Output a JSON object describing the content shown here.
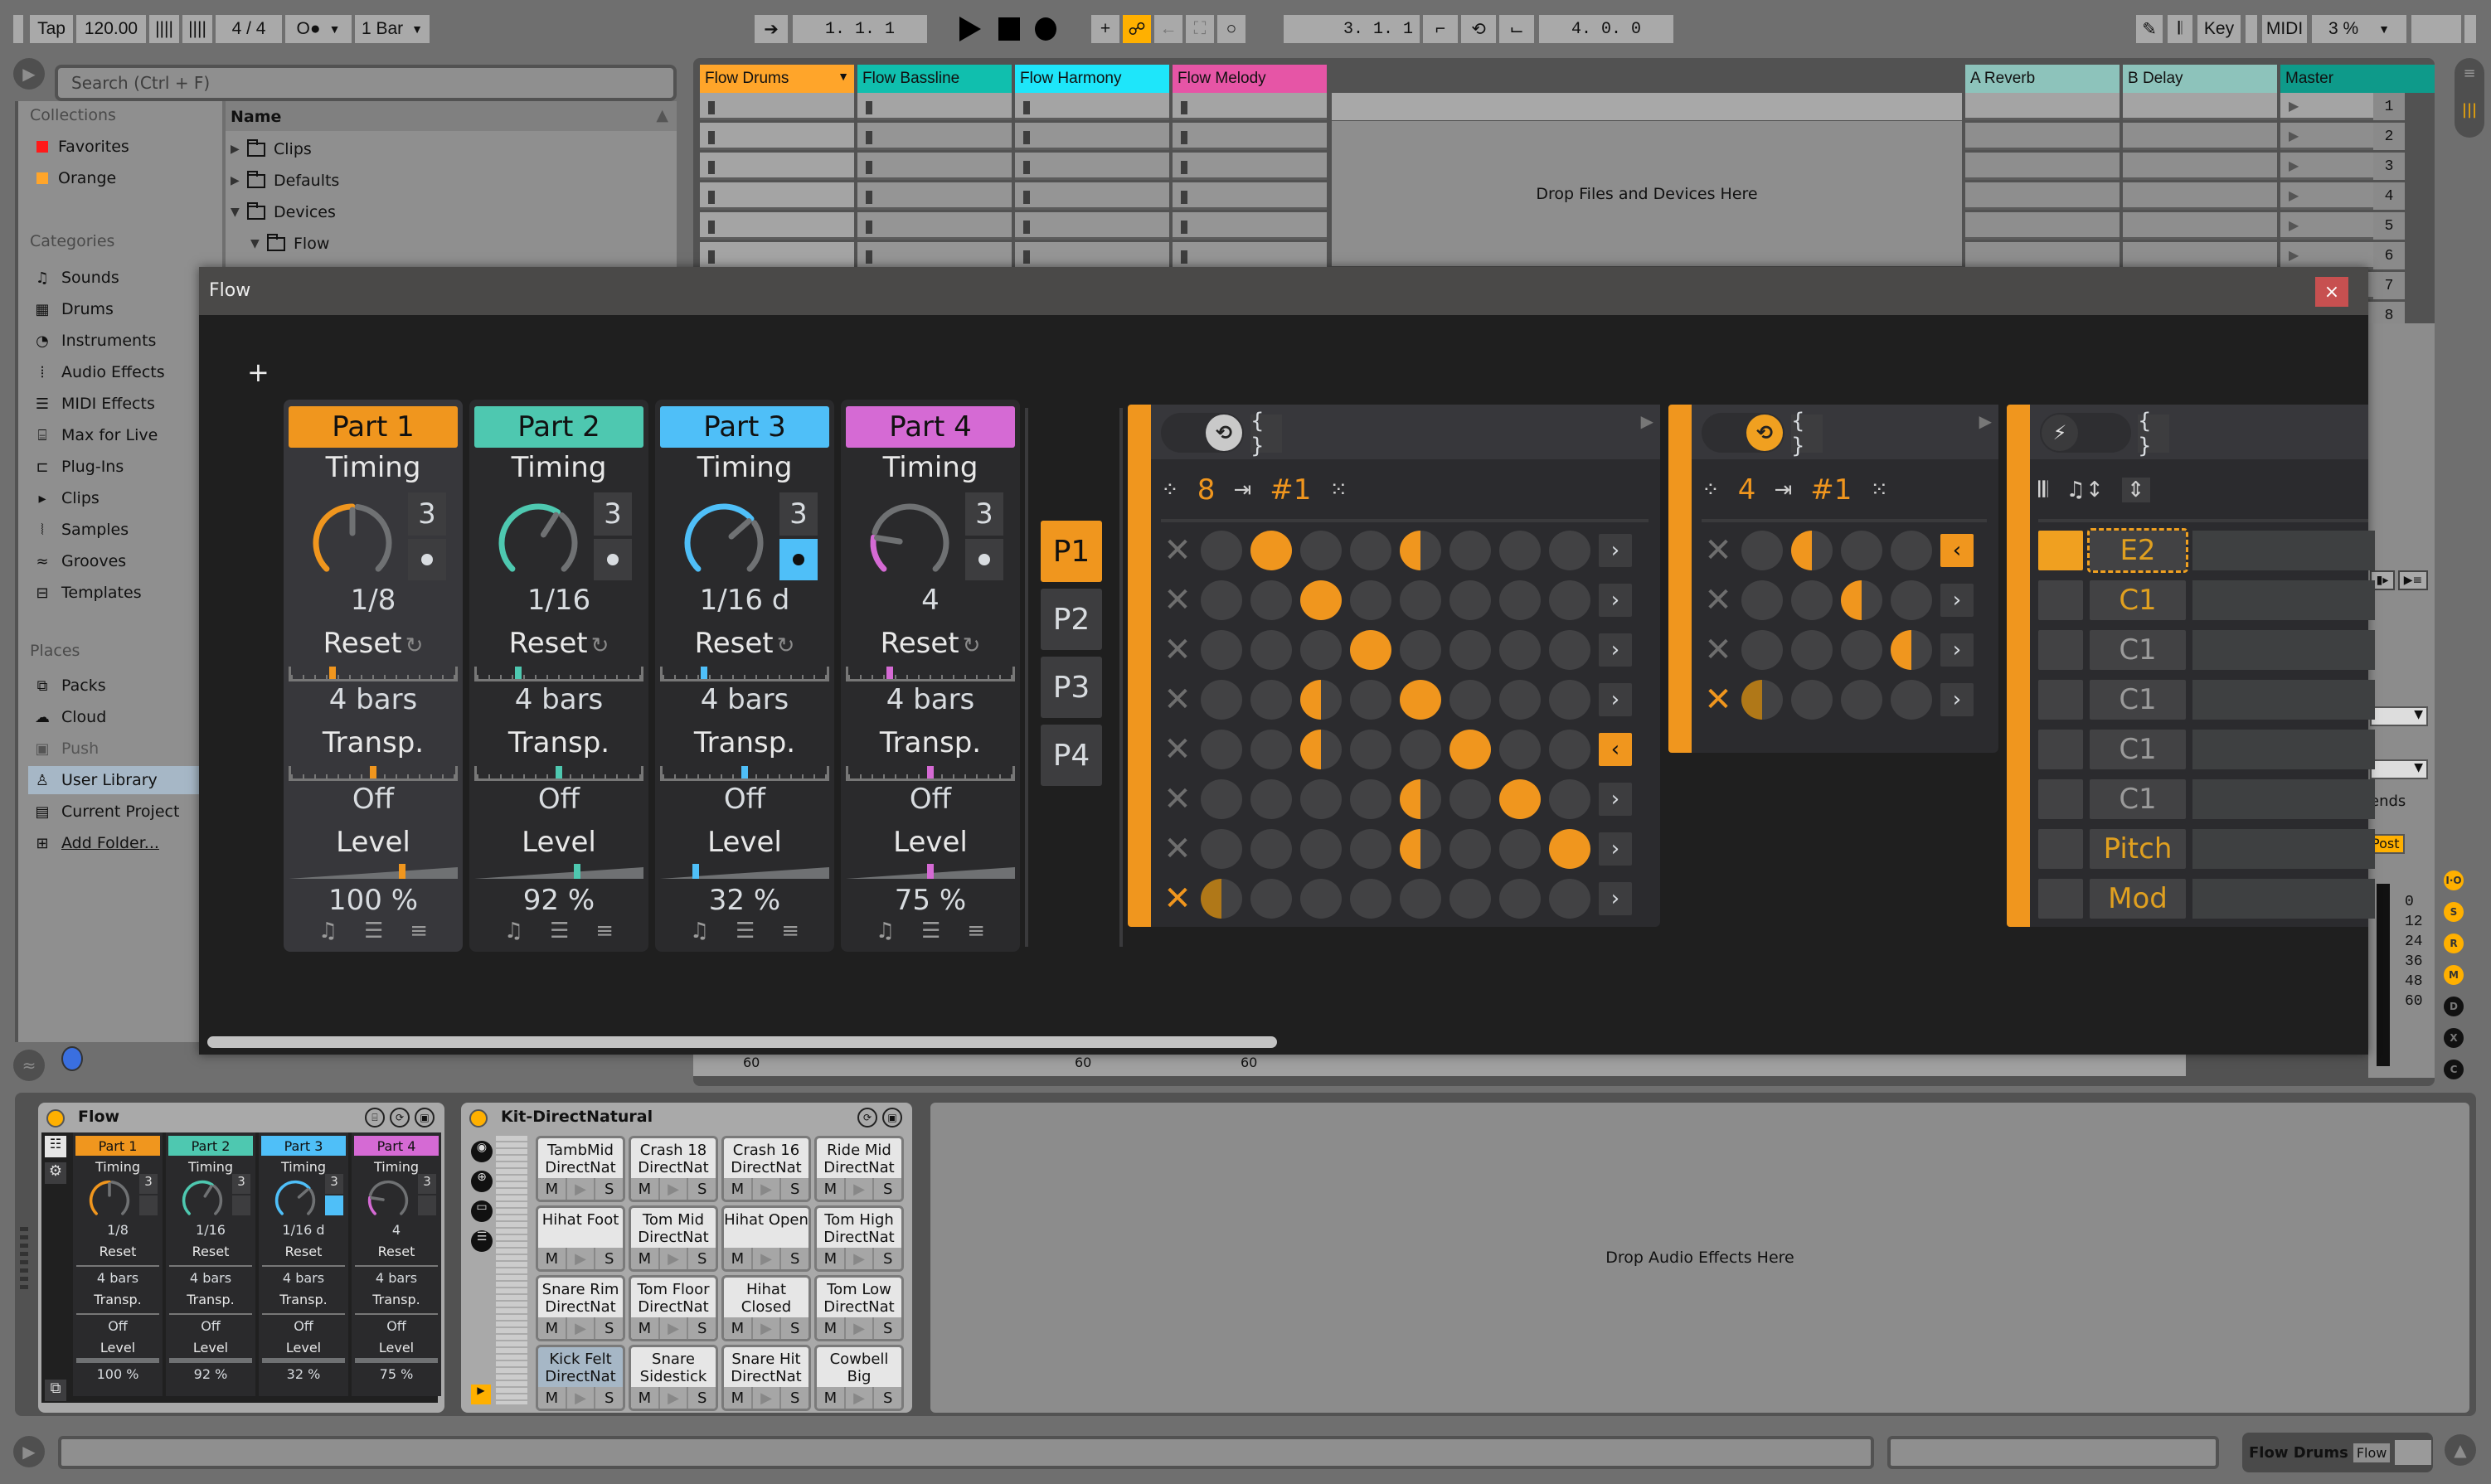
{
  "transport": {
    "tap_label": "Tap",
    "tempo": "120.00",
    "time_signature": "4 / 4",
    "metronome_label": "O●",
    "quantize": "1 Bar",
    "arrangement_position": "1.  1.  1",
    "loop_start": "3.  1.  1",
    "loop_length": "4.  0.  0",
    "key_label": "Key",
    "midi_label": "MIDI",
    "cpu_load": "3 %",
    "accent_color": "#ffb000"
  },
  "browser": {
    "search_placeholder": "Search (Ctrl + F)",
    "collections_title": "Collections",
    "collections": [
      {
        "label": "Favorites",
        "color": "#ff1a1a"
      },
      {
        "label": "Orange",
        "color": "#ffa52a"
      }
    ],
    "categories_title": "Categories",
    "categories": [
      {
        "label": "Sounds",
        "icon": "♫"
      },
      {
        "label": "Drums",
        "icon": "▦"
      },
      {
        "label": "Instruments",
        "icon": "◔"
      },
      {
        "label": "Audio Effects",
        "icon": "⦙"
      },
      {
        "label": "MIDI Effects",
        "icon": "☰"
      },
      {
        "label": "Max for Live",
        "icon": "⌸"
      },
      {
        "label": "Plug-Ins",
        "icon": "⊏"
      },
      {
        "label": "Clips",
        "icon": "▸"
      },
      {
        "label": "Samples",
        "icon": "⦚"
      },
      {
        "label": "Grooves",
        "icon": "≈"
      },
      {
        "label": "Templates",
        "icon": "⊟"
      }
    ],
    "places_title": "Places",
    "places": [
      {
        "label": "Packs",
        "icon": "⧉"
      },
      {
        "label": "Cloud",
        "icon": "☁"
      },
      {
        "label": "Push",
        "icon": "▣"
      },
      {
        "label": "User Library",
        "icon": "♙"
      },
      {
        "label": "Current Project",
        "icon": "▤"
      },
      {
        "label": "Add Folder...",
        "icon": "⊞"
      }
    ],
    "name_header": "Name",
    "files": [
      {
        "label": "Clips",
        "expanded": false
      },
      {
        "label": "Defaults",
        "expanded": false
      },
      {
        "label": "Devices",
        "expanded": true
      },
      {
        "label": "Flow",
        "expanded": true
      }
    ]
  },
  "session": {
    "tracks": [
      {
        "name": "Flow Drums",
        "color": "#ffa52a"
      },
      {
        "name": "Flow Bassline",
        "color": "#10bfae"
      },
      {
        "name": "Flow Harmony",
        "color": "#1ee6fa"
      },
      {
        "name": "Flow Melody",
        "color": "#e655a6"
      }
    ],
    "returns": [
      {
        "name": "A Reverb",
        "color": "#8dc3bb"
      },
      {
        "name": "B Delay",
        "color": "#8dc3bb"
      }
    ],
    "master": {
      "name": "Master",
      "color": "#0e9a8a"
    },
    "scenes": [
      "1",
      "2",
      "3",
      "4",
      "5",
      "6",
      "7",
      "8"
    ],
    "drop_hint": "Drop Files and Devices Here",
    "meter_label": "60",
    "sends_label": "ends",
    "post_label": "Post",
    "master_scale": [
      "0",
      "12",
      "24",
      "36",
      "48",
      "60"
    ],
    "mixer_toggles": [
      "I·O",
      "S",
      "R",
      "M",
      "D",
      "X",
      "C"
    ]
  },
  "flow_window": {
    "title": "Flow",
    "close_label": "×",
    "add_label": "+",
    "parts": [
      {
        "name": "Part 1",
        "color": "#f0961e",
        "timing_label": "Timing",
        "triplet": "3",
        "dotted": false,
        "timing_value": "1/8",
        "timing_knob": 0.5,
        "reset_label": "Reset",
        "reset_value": "4 bars",
        "reset_pos": 0.25,
        "transp_label": "Transp.",
        "transp_value": "Off",
        "transp_pos": 0.5,
        "level_label": "Level",
        "level_value": "100 %",
        "level_pos": 0.67
      },
      {
        "name": "Part 2",
        "color": "#4ec8b0",
        "timing_label": "Timing",
        "triplet": "3",
        "dotted": false,
        "timing_value": "1/16",
        "timing_knob": 0.62,
        "reset_label": "Reset",
        "reset_value": "4 bars",
        "reset_pos": 0.25,
        "transp_label": "Transp.",
        "transp_value": "Off",
        "transp_pos": 0.5,
        "level_label": "Level",
        "level_value": "92 %",
        "level_pos": 0.61
      },
      {
        "name": "Part 3",
        "color": "#4fbff8",
        "timing_label": "Timing",
        "triplet": "3",
        "dotted": true,
        "timing_value": "1/16 d",
        "timing_knob": 0.68,
        "reset_label": "Reset",
        "reset_value": "4 bars",
        "reset_pos": 0.25,
        "transp_label": "Transp.",
        "transp_value": "Off",
        "transp_pos": 0.5,
        "level_label": "Level",
        "level_value": "32 %",
        "level_pos": 0.21
      },
      {
        "name": "Part 4",
        "color": "#d56ad4",
        "timing_label": "Timing",
        "triplet": "3",
        "dotted": false,
        "timing_value": "4",
        "timing_knob": 0.2,
        "reset_label": "Reset",
        "reset_value": "4 bars",
        "reset_pos": 0.25,
        "transp_label": "Transp.",
        "transp_value": "Off",
        "transp_pos": 0.5,
        "level_label": "Level",
        "level_value": "75 %",
        "level_pos": 0.5
      }
    ],
    "patterns": [
      "P1",
      "P2",
      "P3",
      "P4"
    ],
    "active_pattern": 0,
    "grid1": {
      "steps": "8",
      "input": "#1",
      "brace": "{ }",
      "cells": [
        [
          0,
          1,
          0,
          0,
          0.4,
          0,
          0,
          0
        ],
        [
          0,
          0,
          1,
          0,
          0,
          0,
          0,
          0
        ],
        [
          0,
          0,
          0,
          1,
          0,
          0,
          0,
          0
        ],
        [
          0,
          0,
          0.4,
          0,
          1,
          0,
          0,
          0
        ],
        [
          0,
          0,
          0.4,
          0,
          0,
          1,
          0,
          0
        ],
        [
          0,
          0,
          0,
          0,
          0.45,
          0,
          1,
          0
        ],
        [
          0,
          0,
          0,
          0,
          0.45,
          0,
          0,
          1
        ],
        [
          0.5,
          0,
          0,
          0,
          0,
          0,
          0,
          0
        ]
      ],
      "active_row": 7,
      "reversed_rows": [
        4
      ]
    },
    "grid2": {
      "steps": "4",
      "input": "#1",
      "brace": "{ }",
      "cells": [
        [
          0,
          0.5,
          0,
          0
        ],
        [
          0,
          0,
          0.5,
          0
        ],
        [
          0,
          0,
          0,
          0.5
        ],
        [
          0.5,
          0,
          0,
          0
        ]
      ],
      "active_row": 3,
      "reversed_rows": [
        0
      ]
    },
    "mod_panel": {
      "brace": "{ }",
      "rows": [
        {
          "label": "E2",
          "active": true,
          "highlight": true
        },
        {
          "label": "C1",
          "active": false,
          "highlight": true
        },
        {
          "label": "C1",
          "active": false,
          "highlight": false
        },
        {
          "label": "C1",
          "active": false,
          "highlight": false
        },
        {
          "label": "C1",
          "active": false,
          "highlight": false
        },
        {
          "label": "C1",
          "active": false,
          "highlight": false
        },
        {
          "label": "Pitch",
          "active": false,
          "highlight": true
        },
        {
          "label": "Mod",
          "active": false,
          "highlight": true
        }
      ]
    }
  },
  "devices": {
    "flow": {
      "title": "Flow",
      "parts": [
        {
          "name": "Part 1",
          "color": "#f0961e",
          "timing": "1/8",
          "level": "100 %"
        },
        {
          "name": "Part 2",
          "color": "#4ec8b0",
          "timing": "1/16",
          "level": "92 %"
        },
        {
          "name": "Part 3",
          "color": "#4fbff8",
          "timing": "1/16 d",
          "level": "32 %"
        },
        {
          "name": "Part 4",
          "color": "#d56ad4",
          "timing": "4",
          "level": "75 %"
        }
      ],
      "labels": {
        "timing": "Timing",
        "reset": "Reset",
        "bars": "4 bars",
        "transp": "Transp.",
        "off": "Off",
        "level": "Level",
        "triplet": "3"
      }
    },
    "kit": {
      "title": "Kit-DirectNatural",
      "pads": [
        {
          "name": "TambMid DirectNat"
        },
        {
          "name": "Crash 18 DirectNat"
        },
        {
          "name": "Crash 16 DirectNat"
        },
        {
          "name": "Ride Mid DirectNat"
        },
        {
          "name": "Hihat Foot"
        },
        {
          "name": "Tom Mid DirectNat"
        },
        {
          "name": "Hihat Open"
        },
        {
          "name": "Tom High DirectNat"
        },
        {
          "name": "Snare Rim DirectNat"
        },
        {
          "name": "Tom Floor DirectNat"
        },
        {
          "name": "Hihat Closed"
        },
        {
          "name": "Tom Low DirectNat"
        },
        {
          "name": "Kick Felt DirectNat",
          "selected": true
        },
        {
          "name": "Snare Sidestick"
        },
        {
          "name": "Snare Hit DirectNat"
        },
        {
          "name": "Cowbell Big"
        }
      ],
      "mute_label": "M",
      "solo_label": "S"
    },
    "drop_audio_hint": "Drop Audio Effects Here"
  },
  "status_bar": {
    "track_name": "Flow Drums",
    "device_thumb": "Flow"
  }
}
